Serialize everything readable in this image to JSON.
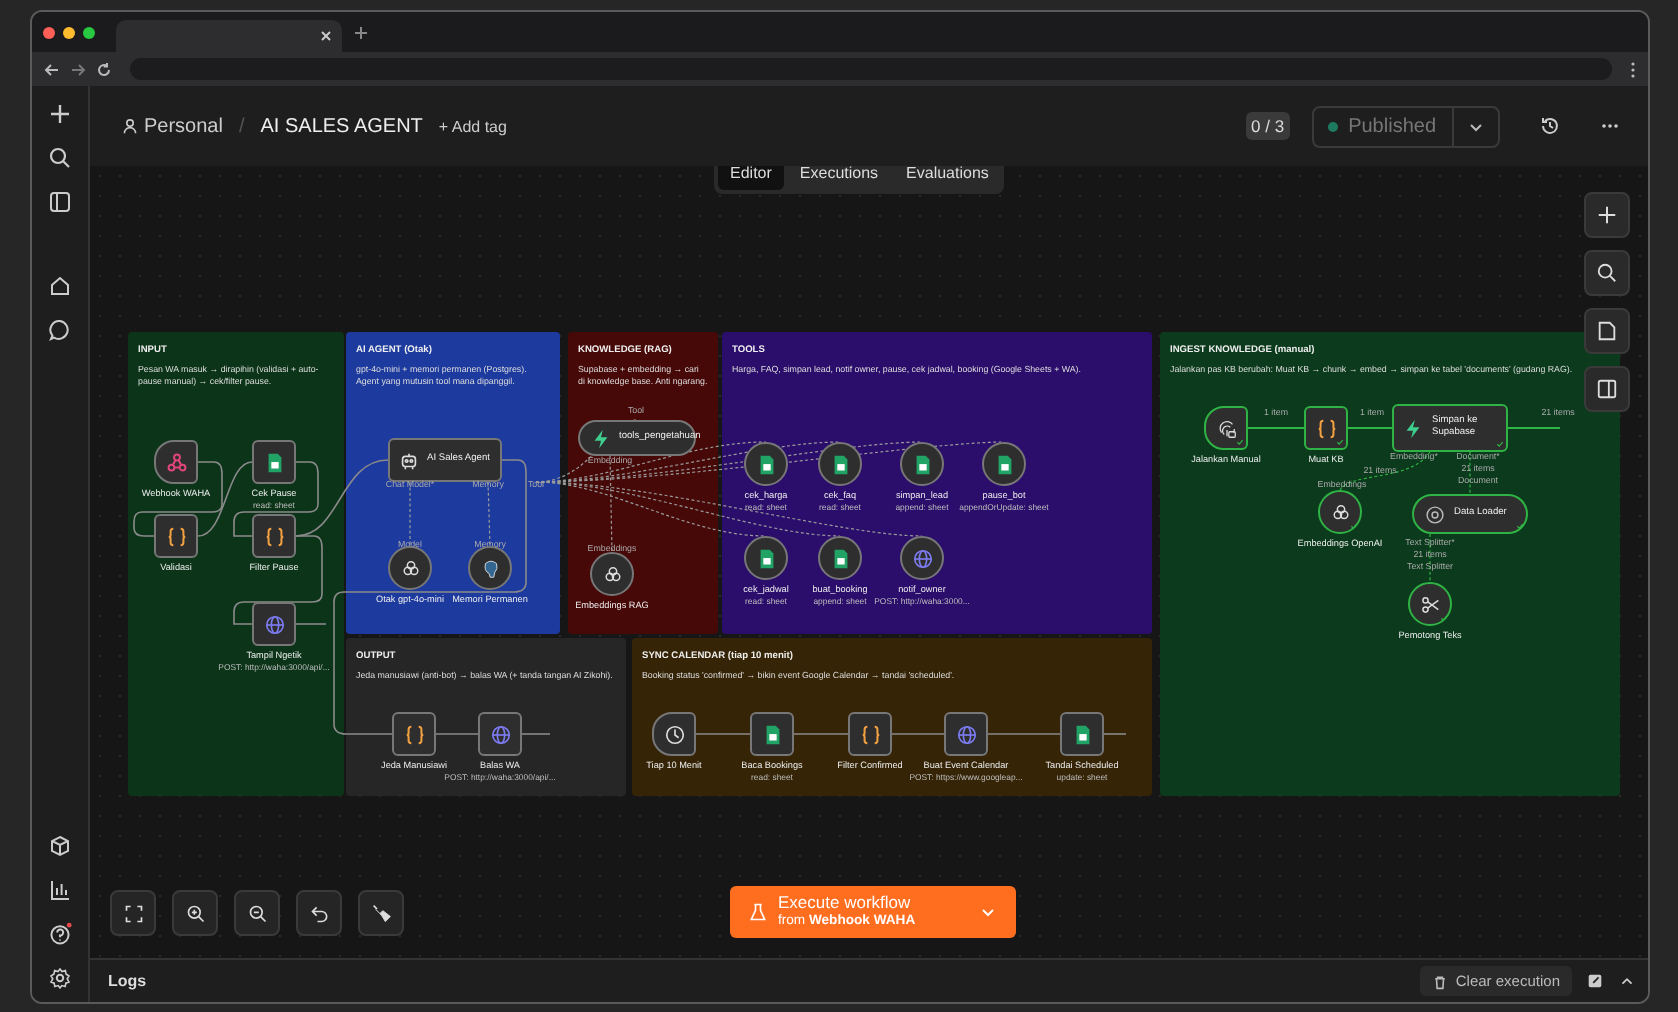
{
  "workspace": {
    "project": "Personal",
    "separator": "/",
    "workflow_name": "AI SALES AGENT",
    "add_tag": "+ Add tag",
    "counter": "0 / 3",
    "publish_status": "Published"
  },
  "view_tabs": [
    {
      "label": "Editor",
      "selected": true
    },
    {
      "label": "Executions",
      "selected": false
    },
    {
      "label": "Evaluations",
      "selected": false
    }
  ],
  "canvas": {
    "groups": [
      {
        "title": "INPUT",
        "description": "Pesan WA masuk → dirapihin (validasi + auto-pause manual) → cek/filter pause.",
        "color": "#0c3419",
        "nodes": [
          {
            "label": "Webhook WAHA",
            "kind": "webhook",
            "executed": false
          },
          {
            "label": "Cek Pause",
            "detail": "read: sheet",
            "kind": "sheets",
            "executed": false
          },
          {
            "label": "Validasi",
            "kind": "code",
            "executed": false
          },
          {
            "label": "Filter Pause",
            "kind": "code",
            "executed": false
          },
          {
            "label": "Tampil Ngetik",
            "detail": "POST: http://waha:3000/api/...",
            "kind": "http",
            "executed": false
          }
        ]
      },
      {
        "title": "AI AGENT (Otak)",
        "description": "gpt-4o-mini + memori permanen (Postgres). Agent yang mutusin tool mana dipanggil.",
        "color": "#1d3a9e",
        "nodes": [
          {
            "label": "AI Sales Agent",
            "kind": "agent",
            "executed": false
          },
          {
            "label": "Otak gpt-4o-mini",
            "kind": "openai",
            "executed": false
          },
          {
            "label": "Memori Permanen",
            "kind": "postgres",
            "executed": false
          }
        ]
      },
      {
        "title": "KNOWLEDGE (RAG)",
        "description": "Supabase + embedding → cari di knowledge base. Anti ngarang.",
        "color": "#470808",
        "nodes": [
          {
            "label": "tools_pengetahuan",
            "kind": "vector",
            "executed": false
          },
          {
            "label": "Embeddings RAG",
            "kind": "openai",
            "executed": false
          }
        ]
      },
      {
        "title": "TOOLS",
        "description": "Harga, FAQ, simpan lead, notif owner, pause, cek jadwal, booking (Google Sheets + WA).",
        "color": "#2b0d6b",
        "nodes": [
          {
            "label": "cek_harga",
            "detail": "read: sheet",
            "kind": "sheets",
            "executed": false
          },
          {
            "label": "cek_faq",
            "detail": "read: sheet",
            "kind": "sheets",
            "executed": false
          },
          {
            "label": "simpan_lead",
            "detail": "append: sheet",
            "kind": "sheets",
            "executed": false
          },
          {
            "label": "pause_bot",
            "detail": "appendOrUpdate: sheet",
            "kind": "sheets",
            "executed": false
          },
          {
            "label": "cek_jadwal",
            "detail": "read: sheet",
            "kind": "sheets",
            "executed": false
          },
          {
            "label": "buat_booking",
            "detail": "append: sheet",
            "kind": "sheets",
            "executed": false
          },
          {
            "label": "notif_owner",
            "detail": "POST: http://waha:3000...",
            "kind": "http",
            "executed": false
          }
        ]
      },
      {
        "title": "INGEST KNOWLEDGE (manual)",
        "description": "Jalankan pas KB berubah: Muat KB → chunk → embed → simpan ke tabel 'documents' (gudang RAG).",
        "color": "#0b3a1c",
        "nodes": [
          {
            "label": "Jalankan Manual",
            "kind": "manual",
            "executed": true
          },
          {
            "label": "Muat KB",
            "kind": "code",
            "executed": true
          },
          {
            "label": "Simpan ke Supabase",
            "kind": "vector",
            "executed": true
          },
          {
            "label": "Embeddings OpenAI",
            "kind": "openai",
            "executed": true
          },
          {
            "label": "Data Loader",
            "kind": "loader",
            "executed": true
          },
          {
            "label": "Pemotong Teks",
            "kind": "splitter",
            "executed": true
          }
        ]
      },
      {
        "title": "OUTPUT",
        "description": "Jeda manusiawi (anti-bot) → balas WA (+ tanda tangan AI Zikohi).",
        "color": "#262626",
        "nodes": [
          {
            "label": "Jeda Manusiawi",
            "kind": "code",
            "executed": false
          },
          {
            "label": "Balas WA",
            "detail": "POST: http://waha:3000/api/...",
            "kind": "http",
            "executed": false
          }
        ]
      },
      {
        "title": "SYNC CALENDAR (tiap 10 menit)",
        "description": "Booking status 'confirmed' → bikin event Google Calendar → tandai 'scheduled'.",
        "color": "#352406",
        "nodes": [
          {
            "label": "Tiap 10 Menit",
            "kind": "schedule",
            "executed": false
          },
          {
            "label": "Baca Bookings",
            "detail": "read: sheet",
            "kind": "sheets",
            "executed": false
          },
          {
            "label": "Filter Confirmed",
            "kind": "code",
            "executed": false
          },
          {
            "label": "Buat Event Calendar",
            "detail": "POST: https://www.googleap...",
            "kind": "http",
            "executed": false
          },
          {
            "label": "Tandai Scheduled",
            "detail": "update: sheet",
            "kind": "sheets",
            "executed": false
          }
        ]
      }
    ],
    "edge_labels": [
      "Chat Model*",
      "Memory",
      "Tool",
      "Model",
      "Memory",
      "Tool",
      "Embedding",
      "Embeddings",
      "1 item",
      "1 item",
      "21 items",
      "Embedding*",
      "Document*",
      "21 items",
      "21 items",
      "Document",
      "Embeddings",
      "Text Splitter*",
      "21 items",
      "Text Splitter"
    ]
  },
  "execute_button": {
    "label": "Execute workflow",
    "source": "from **Webhook WAHA**"
  },
  "logs": {
    "title": "Logs",
    "clear_button": "Clear execution"
  }
}
